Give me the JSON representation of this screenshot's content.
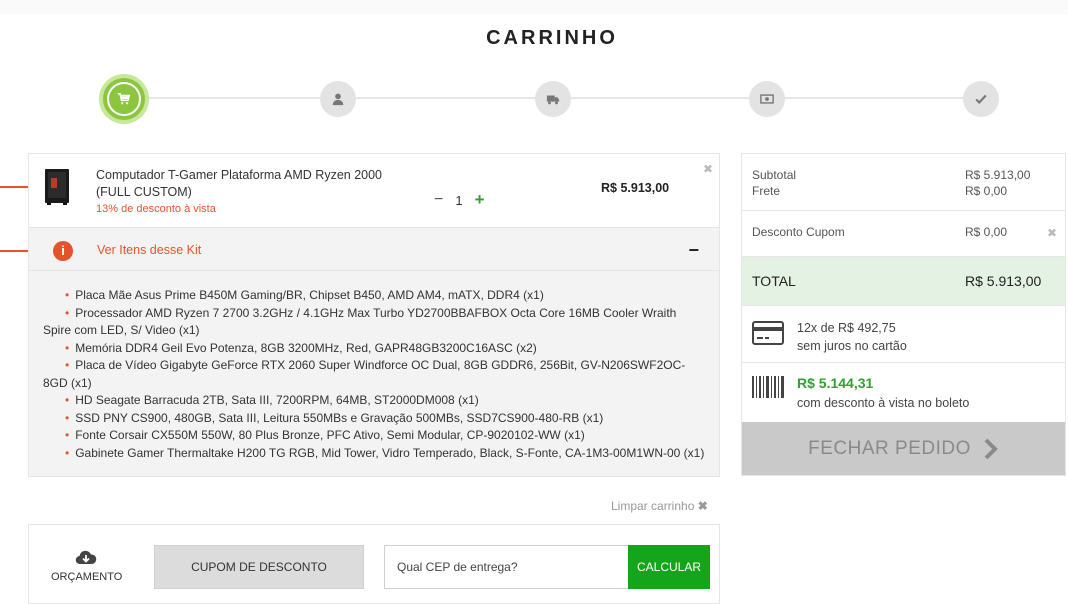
{
  "page": {
    "title": "CARRINHO"
  },
  "steps": [
    {
      "icon": "cart-icon",
      "active": true
    },
    {
      "icon": "user-icon",
      "active": false
    },
    {
      "icon": "truck-icon",
      "active": false
    },
    {
      "icon": "money-icon",
      "active": false
    },
    {
      "icon": "check-icon",
      "active": false
    }
  ],
  "cart_item": {
    "name": "Computador T-Gamer Plataforma AMD Ryzen 2000 (FULL CUSTOM)",
    "discount_note": "13% de desconto à vista",
    "quantity": "1",
    "minus": "−",
    "plus": "+",
    "price": "R$ 5.913,00",
    "remove": "✖"
  },
  "kit": {
    "icon_label": "i",
    "toggle_label": "Ver Itens desse Kit",
    "toggle_symbol": "−",
    "items": [
      "Placa Mãe Asus Prime B450M Gaming/BR, Chipset B450, AMD AM4, mATX, DDR4 (x1)",
      "Processador AMD Ryzen 7 2700 3.2GHz / 4.1GHz Max Turbo YD2700BBAFBOX Octa Core 16MB Cooler Wraith Spire com LED, S/ Video (x1)",
      "Memória DDR4 Geil Evo Potenza, 8GB 3200MHz, Red, GAPR48GB3200C16ASC (x2)",
      "Placa de Vídeo Gigabyte GeForce RTX 2060 Super Windforce OC Dual, 8GB GDDR6, 256Bit, GV-N206SWF2OC-8GD (x1)",
      "HD Seagate Barracuda 2TB, Sata III, 7200RPM, 64MB, ST2000DM008 (x1)",
      "SSD PNY CS900, 480GB, Sata III, Leitura 550MBs e Gravação 500MBs, SSD7CS900-480-RB (x1)",
      "Fonte Corsair CX550M 550W, 80 Plus Bronze, PFC Ativo, Semi Modular, CP-9020102-WW (x1)",
      "Gabinete Gamer Thermaltake H200 TG RGB, Mid Tower, Vidro Temperado, Black, S-Fonte, CA-1M3-00M1WN-00 (x1)"
    ]
  },
  "clear_cart": {
    "label": "Limpar carrinho",
    "icon": "✖"
  },
  "actions": {
    "budget_label": "ORÇAMENTO",
    "coupon_label": "CUPOM DE DESCONTO",
    "cep_placeholder": "Qual CEP de entrega?",
    "calculate_label": "CALCULAR"
  },
  "summary": {
    "subtotal_label": "Subtotal",
    "subtotal_value": "R$ 5.913,00",
    "shipping_label": "Frete",
    "shipping_value": "R$ 0,00",
    "coupon_label": "Desconto Cupom",
    "coupon_value": "R$ 0,00",
    "coupon_remove": "✖",
    "total_label": "TOTAL",
    "total_value": "R$ 5.913,00",
    "installments_line1": "12x de R$ 492,75",
    "installments_line2": "sem juros no cartão",
    "boleto_price": "R$ 5.144,31",
    "boleto_note": "com desconto à vista no boleto",
    "checkout_label": "FECHAR PEDIDO"
  },
  "colors": {
    "accent_green": "#8cc63f",
    "button_green": "#14a51c",
    "discount_orange": "#e5532d",
    "total_bg": "#e3f2e3"
  }
}
